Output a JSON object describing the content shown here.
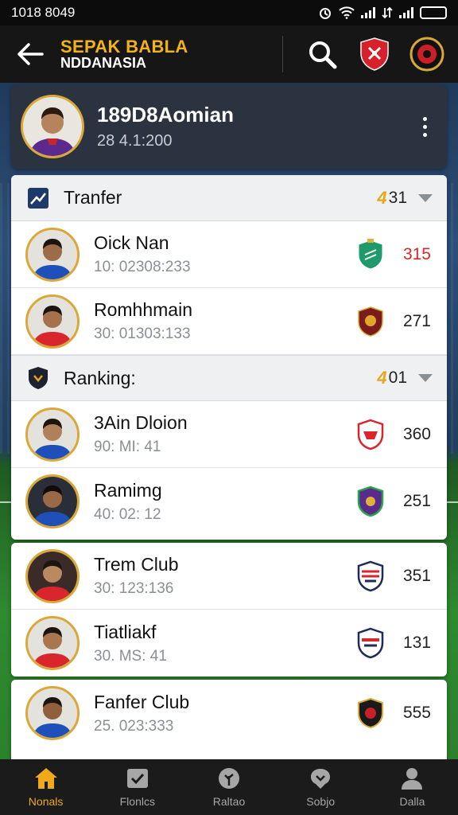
{
  "status_bar": {
    "time": "1018 8049"
  },
  "header": {
    "title": "SEPAK BABLA",
    "subtitle": "NDDANASIA"
  },
  "profile": {
    "name": "189D8Aomian",
    "date": "28 4.1:200"
  },
  "sections": [
    {
      "title": "Tranfer",
      "count": "31",
      "icon": "chart-icon",
      "rows": [
        {
          "name": "Oick Nan",
          "meta": "10: 02308:233",
          "score": "315",
          "kit": "blue",
          "crest": "green"
        },
        {
          "name": "Romhhmain",
          "meta": "30: 01303:133",
          "score": "271",
          "kit": "red",
          "crest": "maroon"
        }
      ]
    },
    {
      "title": "Ranking:",
      "count": "01",
      "icon": "shield-icon",
      "rows": [
        {
          "name": "3Ain Dloion",
          "meta": "90: MI: 41",
          "score": "360",
          "kit": "blue",
          "crest": "red"
        },
        {
          "name": "Ramimg",
          "meta": "40: 02: 12",
          "score": "251",
          "kit": "blue",
          "crest": "purple"
        }
      ]
    }
  ],
  "clubs": [
    {
      "name": "Trem Club",
      "meta": "30: 123:136",
      "score": "351",
      "kit": "red",
      "crest": "navy-red"
    },
    {
      "name": "Tiatliakf",
      "meta": "30. MS: 41",
      "score": "131",
      "kit": "red",
      "crest": "navy-red"
    }
  ],
  "fanfer": [
    {
      "name": "Fanfer Club",
      "meta": "25. 023:333",
      "score": "555",
      "kit": "blue",
      "crest": "black-gold"
    }
  ],
  "nav": [
    {
      "label": "Nonals",
      "icon": "home-icon",
      "active": true
    },
    {
      "label": "Flonlcs",
      "icon": "inbox-icon",
      "active": false
    },
    {
      "label": "Raltao",
      "icon": "tree-icon",
      "active": false
    },
    {
      "label": "Sobjo",
      "icon": "chat-icon",
      "active": false
    },
    {
      "label": "Dalla",
      "icon": "user-icon",
      "active": false
    }
  ],
  "colors": {
    "accent": "#f0a81c",
    "score_highlight": "#d6282b",
    "header_bg": "#161616",
    "profile_bg": "#2b3340"
  }
}
